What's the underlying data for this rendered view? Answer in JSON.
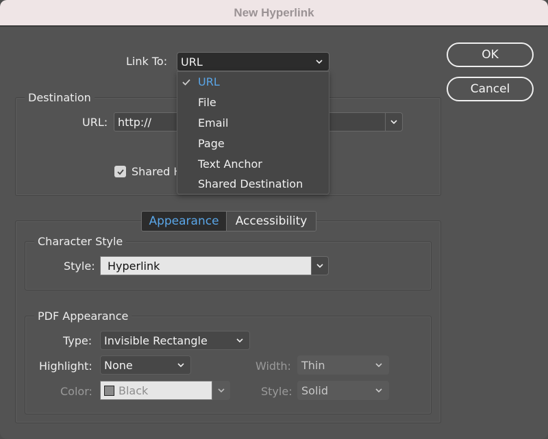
{
  "window": {
    "title": "New Hyperlink"
  },
  "link_to": {
    "label": "Link To:",
    "value": "URL",
    "menu": {
      "items": [
        {
          "label": "URL",
          "selected": true
        },
        {
          "label": "File",
          "selected": false
        },
        {
          "label": "Email",
          "selected": false
        },
        {
          "label": "Page",
          "selected": false
        },
        {
          "label": "Text Anchor",
          "selected": false
        },
        {
          "label": "Shared Destination",
          "selected": false
        }
      ]
    }
  },
  "destination": {
    "title": "Destination",
    "url_label": "URL:",
    "url_value": "http://",
    "shared_checkbox": {
      "label": "Shared Hyperlink Destination",
      "visible_label": "Shared H",
      "checked": true
    }
  },
  "buttons": {
    "ok": "OK",
    "cancel": "Cancel"
  },
  "tabs": [
    {
      "label": "Appearance",
      "active": true
    },
    {
      "label": "Accessibility",
      "active": false
    }
  ],
  "character_style": {
    "title": "Character Style",
    "style_label": "Style:",
    "style_value": "Hyperlink"
  },
  "pdf_appearance": {
    "title": "PDF Appearance",
    "type_label": "Type:",
    "type_value": "Invisible Rectangle",
    "highlight_label": "Highlight:",
    "highlight_value": "None",
    "color_label": "Color:",
    "color_value": "Black",
    "color_swatch": "#8a8a8a",
    "width_label": "Width:",
    "width_value": "Thin",
    "style_label": "Style:",
    "style_value": "Solid"
  },
  "colors": {
    "accent": "#5aa6e8",
    "background": "#535353",
    "titlebar": "#efe5e6"
  }
}
